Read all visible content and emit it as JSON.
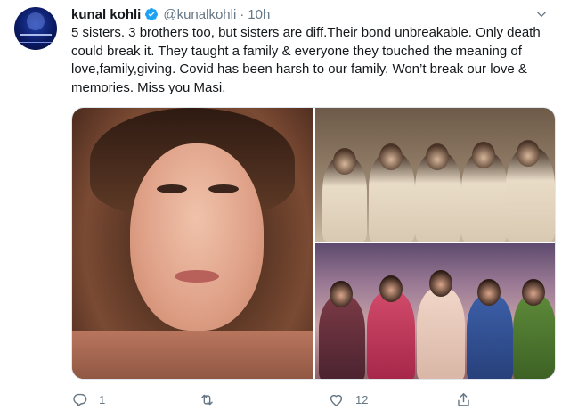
{
  "tweet": {
    "author_name": "kunal kohli",
    "handle": "@kunalkohli",
    "separator": "·",
    "time": "10h",
    "text": "5 sisters. 3 brothers too, but sisters are diff.Their bond unbreakable. Only death could break it. They taught a family & everyone they touched the meaning of love,family,giving. Covid has been harsh to our family. Won’t break our love & memories. Miss you Masi.",
    "verified": true
  },
  "icons": {
    "verified": "verified-badge-icon",
    "more": "chevron-down-icon",
    "reply": "reply-icon",
    "retweet": "retweet-icon",
    "like": "heart-icon",
    "share": "share-icon"
  },
  "actions": {
    "reply_count": "1",
    "retweet_count": "",
    "like_count": "12"
  },
  "colors": {
    "accent": "#1da1f2",
    "text": "#14171a",
    "secondary": "#657786"
  }
}
